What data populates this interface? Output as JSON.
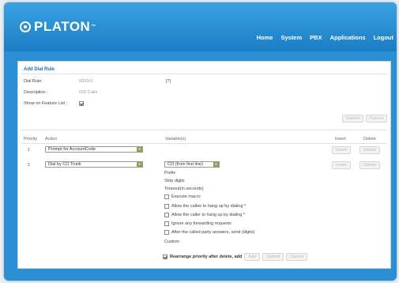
{
  "brand": {
    "name": "PLATON",
    "tm": "™"
  },
  "nav": [
    "Home",
    "System",
    "PBX",
    "Applications",
    "Logout"
  ],
  "form": {
    "title": "Add Dial Rule",
    "dial_rule_label": "Dial Rule:",
    "dial_rule_value": "00XXX.",
    "dial_rule_help": "[?]",
    "description_label": "Description :",
    "description_value": "IDD Calls",
    "show_feature_label": "Show on Feature List :",
    "show_feature_checked": true
  },
  "buttons": {
    "submit": "Submit",
    "cancel": "Cancel"
  },
  "table": {
    "headers": {
      "priority": "Priority",
      "action": "Action",
      "variables": "Variable(s)",
      "insert": "Insert",
      "delete": "Delete"
    },
    "rows": [
      {
        "priority": "1",
        "action": "Prompt for AccountCode",
        "variable": "",
        "insert": "Insert",
        "delete": "Delete"
      },
      {
        "priority": "2",
        "action": "Dial by CO Trunk",
        "variable": "CO (from first line)",
        "insert": "Insert",
        "delete": "Delete"
      }
    ]
  },
  "variables": {
    "prefix": "Prefix",
    "strip": "Strip digits",
    "timeout": "Timeout(in seconds)",
    "execute_macro": "Execute macro",
    "allow_callee_hangup": "Allow the callee to hang up by dialing *",
    "allow_caller_hangup": "Allow the caller to hang up by dialing *",
    "ignore_forwarding": "Ignore any forwarding requests",
    "after_answer": "After the called party answers, send  (digits)",
    "custom": "Custom"
  },
  "bottom": {
    "rearrange_label": "Rearrange priority after delete, add",
    "rearrange_checked": true,
    "add": "Add",
    "submit": "Submit",
    "cancel": "Cancel"
  }
}
